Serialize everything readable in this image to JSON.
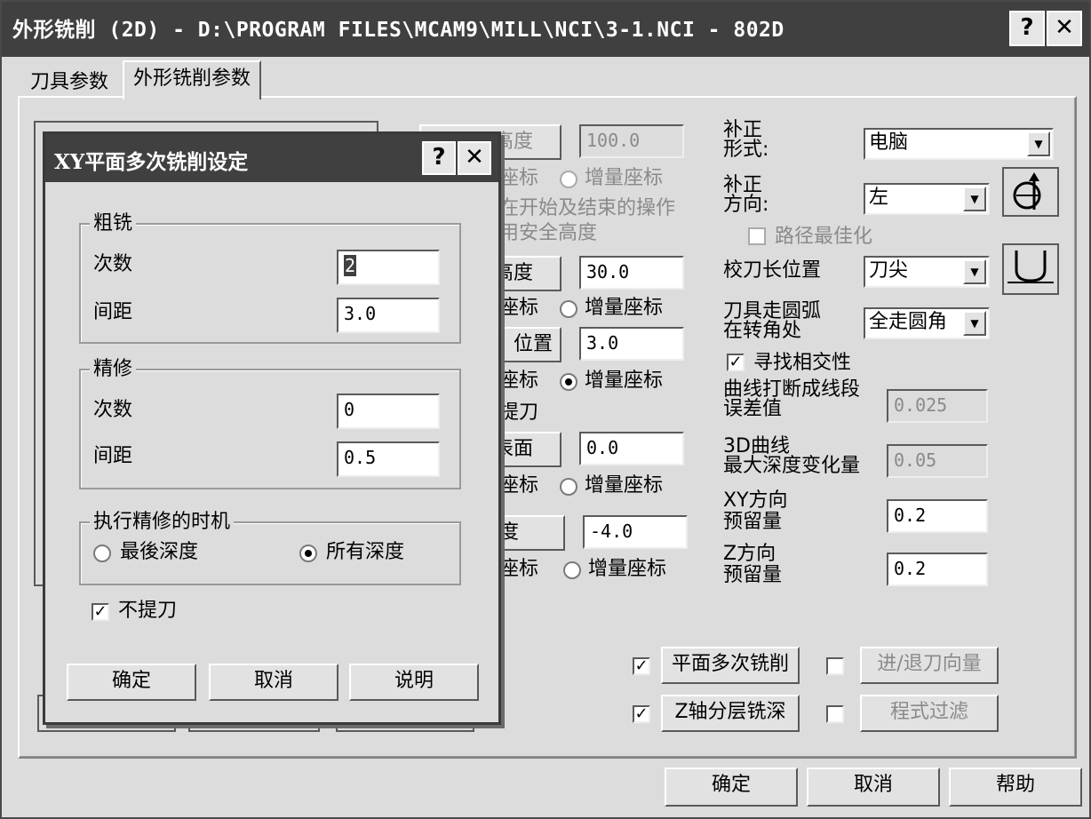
{
  "window": {
    "title": "外形铣削 (2D) - D:\\PROGRAM FILES\\MCAM9\\MILL\\NCI\\3-1.NCI - 802D",
    "help_icon": "?",
    "close_icon": "✕"
  },
  "tabs": [
    {
      "label": "刀具参数"
    },
    {
      "label": "外形铣削参数"
    }
  ],
  "main": {
    "height_btn_1": "高度",
    "height_val_1": "100.0",
    "abs_partial_1": "座标",
    "incr_1": "增量座标",
    "note_line1": "在开始及结束的操作",
    "note_line2": "用安全高度",
    "height_btn_2": "高度",
    "height_val_2": "30.0",
    "abs_partial_2": "座标",
    "incr_2": "增量座标",
    "pos_btn": "位置",
    "pos_val": "3.0",
    "abs_partial_3": "座标",
    "incr_3": "增量座标",
    "tool_lift": "提刀",
    "surface_btn": "表面",
    "surface_val": "0.0",
    "abs_partial_4": "座标",
    "incr_4": "增量座标",
    "depth_btn": "度",
    "depth_val": "-4.0",
    "abs_partial_5": "座标",
    "incr_5": "增量座标"
  },
  "right": {
    "comp_type_label": "补正\n形式:",
    "comp_type_value": "电脑",
    "comp_dir_label": "补正\n方向:",
    "comp_dir_value": "左",
    "path_opt": "路径最佳化",
    "tip_label": "校刀长位置",
    "tip_value": "刀尖",
    "arc_label": "刀具走圆弧\n在转角处",
    "arc_value": "全走圆角",
    "intersect": "寻找相交性",
    "break_label": "曲线打断成线段\n误差值",
    "break_value": "0.025",
    "depth3d_label": "3D曲线\n最大深度变化量",
    "depth3d_value": "0.05",
    "xy_stock_label": "XY方向\n预留量",
    "xy_stock_value": "0.2",
    "z_stock_label": "Z方向\n预留量",
    "z_stock_value": "0.2",
    "multi_pass_btn": "平面多次铣削",
    "lead_btn": "进/退刀向量",
    "depth_cut_btn": "Z轴分层铣深",
    "filter_btn": "程式过滤"
  },
  "footer": {
    "ok": "确定",
    "cancel": "取消",
    "help": "帮助"
  },
  "dialog": {
    "title": "XY平面多次铣削设定",
    "rough_group": "粗铣",
    "rough_count_label": "次数",
    "rough_count_value": "2",
    "rough_step_label": "间距",
    "rough_step_value": "3.0",
    "finish_group": "精修",
    "finish_count_label": "次数",
    "finish_count_value": "0",
    "finish_step_label": "间距",
    "finish_step_value": "0.5",
    "timing_group": "执行精修的时机",
    "final_depth": "最後深度",
    "all_depths": "所有深度",
    "no_lift": "不提刀",
    "ok": "确定",
    "cancel": "取消",
    "explain": "说明"
  },
  "colors": {
    "titlebar": "#404040",
    "face": "#dcdcdc",
    "disabled_text": "#8a8a8a"
  }
}
